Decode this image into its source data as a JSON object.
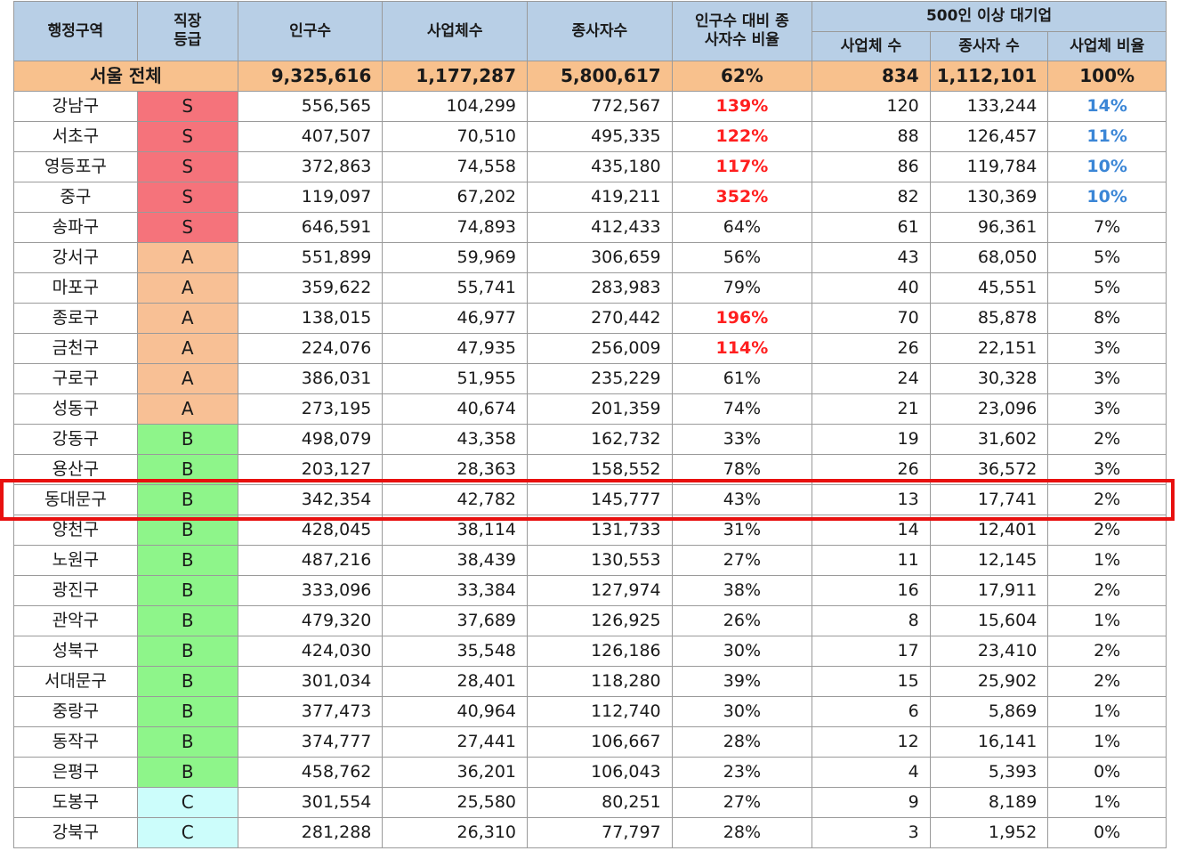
{
  "headers": {
    "district": "행정구역",
    "grade": "직장 등급",
    "population": "인구수",
    "businesses": "사업체수",
    "workers": "종사자수",
    "ratio": "인구수 대비 종사자수 비율",
    "large_group": "500인 이상 대기업",
    "large_businesses": "사업체 수",
    "large_workers": "종사자 수",
    "large_ratio": "사업체 비율"
  },
  "total": {
    "label": "서울 전체",
    "population": "9,325,616",
    "businesses": "1,177,287",
    "workers": "5,800,617",
    "ratio": "62%",
    "large_businesses": "834",
    "large_workers": "1,112,101",
    "large_ratio": "100%"
  },
  "rows": [
    {
      "district": "강남구",
      "grade": "S",
      "population": "556,565",
      "businesses": "104,299",
      "workers": "772,567",
      "ratio": "139%",
      "ratio_hi": true,
      "large_businesses": "120",
      "large_workers": "133,244",
      "large_ratio": "14%",
      "large_hi": true
    },
    {
      "district": "서초구",
      "grade": "S",
      "population": "407,507",
      "businesses": "70,510",
      "workers": "495,335",
      "ratio": "122%",
      "ratio_hi": true,
      "large_businesses": "88",
      "large_workers": "126,457",
      "large_ratio": "11%",
      "large_hi": true
    },
    {
      "district": "영등포구",
      "grade": "S",
      "population": "372,863",
      "businesses": "74,558",
      "workers": "435,180",
      "ratio": "117%",
      "ratio_hi": true,
      "large_businesses": "86",
      "large_workers": "119,784",
      "large_ratio": "10%",
      "large_hi": true
    },
    {
      "district": "중구",
      "grade": "S",
      "population": "119,097",
      "businesses": "67,202",
      "workers": "419,211",
      "ratio": "352%",
      "ratio_hi": true,
      "large_businesses": "82",
      "large_workers": "130,369",
      "large_ratio": "10%",
      "large_hi": true
    },
    {
      "district": "송파구",
      "grade": "S",
      "population": "646,591",
      "businesses": "74,893",
      "workers": "412,433",
      "ratio": "64%",
      "ratio_hi": false,
      "large_businesses": "61",
      "large_workers": "96,361",
      "large_ratio": "7%",
      "large_hi": false
    },
    {
      "district": "강서구",
      "grade": "A",
      "population": "551,899",
      "businesses": "59,969",
      "workers": "306,659",
      "ratio": "56%",
      "ratio_hi": false,
      "large_businesses": "43",
      "large_workers": "68,050",
      "large_ratio": "5%",
      "large_hi": false
    },
    {
      "district": "마포구",
      "grade": "A",
      "population": "359,622",
      "businesses": "55,741",
      "workers": "283,983",
      "ratio": "79%",
      "ratio_hi": false,
      "large_businesses": "40",
      "large_workers": "45,551",
      "large_ratio": "5%",
      "large_hi": false
    },
    {
      "district": "종로구",
      "grade": "A",
      "population": "138,015",
      "businesses": "46,977",
      "workers": "270,442",
      "ratio": "196%",
      "ratio_hi": true,
      "large_businesses": "70",
      "large_workers": "85,878",
      "large_ratio": "8%",
      "large_hi": false
    },
    {
      "district": "금천구",
      "grade": "A",
      "population": "224,076",
      "businesses": "47,935",
      "workers": "256,009",
      "ratio": "114%",
      "ratio_hi": true,
      "large_businesses": "26",
      "large_workers": "22,151",
      "large_ratio": "3%",
      "large_hi": false
    },
    {
      "district": "구로구",
      "grade": "A",
      "population": "386,031",
      "businesses": "51,955",
      "workers": "235,229",
      "ratio": "61%",
      "ratio_hi": false,
      "large_businesses": "24",
      "large_workers": "30,328",
      "large_ratio": "3%",
      "large_hi": false
    },
    {
      "district": "성동구",
      "grade": "A",
      "population": "273,195",
      "businesses": "40,674",
      "workers": "201,359",
      "ratio": "74%",
      "ratio_hi": false,
      "large_businesses": "21",
      "large_workers": "23,096",
      "large_ratio": "3%",
      "large_hi": false
    },
    {
      "district": "강동구",
      "grade": "B",
      "population": "498,079",
      "businesses": "43,358",
      "workers": "162,732",
      "ratio": "33%",
      "ratio_hi": false,
      "large_businesses": "19",
      "large_workers": "31,602",
      "large_ratio": "2%",
      "large_hi": false
    },
    {
      "district": "용산구",
      "grade": "B",
      "population": "203,127",
      "businesses": "28,363",
      "workers": "158,552",
      "ratio": "78%",
      "ratio_hi": false,
      "large_businesses": "26",
      "large_workers": "36,572",
      "large_ratio": "3%",
      "large_hi": false
    },
    {
      "district": "동대문구",
      "grade": "B",
      "population": "342,354",
      "businesses": "42,782",
      "workers": "145,777",
      "ratio": "43%",
      "ratio_hi": false,
      "large_businesses": "13",
      "large_workers": "17,741",
      "large_ratio": "2%",
      "large_hi": false
    },
    {
      "district": "양천구",
      "grade": "B",
      "population": "428,045",
      "businesses": "38,114",
      "workers": "131,733",
      "ratio": "31%",
      "ratio_hi": false,
      "large_businesses": "14",
      "large_workers": "12,401",
      "large_ratio": "2%",
      "large_hi": false
    },
    {
      "district": "노원구",
      "grade": "B",
      "population": "487,216",
      "businesses": "38,439",
      "workers": "130,553",
      "ratio": "27%",
      "ratio_hi": false,
      "large_businesses": "11",
      "large_workers": "12,145",
      "large_ratio": "1%",
      "large_hi": false
    },
    {
      "district": "광진구",
      "grade": "B",
      "population": "333,096",
      "businesses": "33,384",
      "workers": "127,974",
      "ratio": "38%",
      "ratio_hi": false,
      "large_businesses": "16",
      "large_workers": "17,911",
      "large_ratio": "2%",
      "large_hi": false
    },
    {
      "district": "관악구",
      "grade": "B",
      "population": "479,320",
      "businesses": "37,689",
      "workers": "126,925",
      "ratio": "26%",
      "ratio_hi": false,
      "large_businesses": "8",
      "large_workers": "15,604",
      "large_ratio": "1%",
      "large_hi": false
    },
    {
      "district": "성북구",
      "grade": "B",
      "population": "424,030",
      "businesses": "35,548",
      "workers": "126,186",
      "ratio": "30%",
      "ratio_hi": false,
      "large_businesses": "17",
      "large_workers": "23,410",
      "large_ratio": "2%",
      "large_hi": false
    },
    {
      "district": "서대문구",
      "grade": "B",
      "population": "301,034",
      "businesses": "28,401",
      "workers": "118,280",
      "ratio": "39%",
      "ratio_hi": false,
      "large_businesses": "15",
      "large_workers": "25,902",
      "large_ratio": "2%",
      "large_hi": false
    },
    {
      "district": "중랑구",
      "grade": "B",
      "population": "377,473",
      "businesses": "40,964",
      "workers": "112,740",
      "ratio": "30%",
      "ratio_hi": false,
      "large_businesses": "6",
      "large_workers": "5,869",
      "large_ratio": "1%",
      "large_hi": false
    },
    {
      "district": "동작구",
      "grade": "B",
      "population": "374,777",
      "businesses": "27,441",
      "workers": "106,667",
      "ratio": "28%",
      "ratio_hi": false,
      "large_businesses": "12",
      "large_workers": "16,141",
      "large_ratio": "1%",
      "large_hi": false
    },
    {
      "district": "은평구",
      "grade": "B",
      "population": "458,762",
      "businesses": "36,201",
      "workers": "106,043",
      "ratio": "23%",
      "ratio_hi": false,
      "large_businesses": "4",
      "large_workers": "5,393",
      "large_ratio": "0%",
      "large_hi": false
    },
    {
      "district": "도봉구",
      "grade": "C",
      "population": "301,554",
      "businesses": "25,580",
      "workers": "80,251",
      "ratio": "27%",
      "ratio_hi": false,
      "large_businesses": "9",
      "large_workers": "8,189",
      "large_ratio": "1%",
      "large_hi": false
    },
    {
      "district": "강북구",
      "grade": "C",
      "population": "281,288",
      "businesses": "26,310",
      "workers": "77,797",
      "ratio": "28%",
      "ratio_hi": false,
      "large_businesses": "3",
      "large_workers": "1,952",
      "large_ratio": "0%",
      "large_hi": false
    }
  ],
  "colors": {
    "header_bg": "#b8cfe6",
    "total_bg": "#f8c18d",
    "grade_S": "#f5737b",
    "grade_A": "#f8c095",
    "grade_B": "#8ef58a",
    "grade_C": "#ccfdfb",
    "highlight_red_text": "#ff1f1f",
    "highlight_blue_text": "#3b86d6",
    "highlight_box": "#e8100f"
  },
  "highlighted_row": "동대문구"
}
